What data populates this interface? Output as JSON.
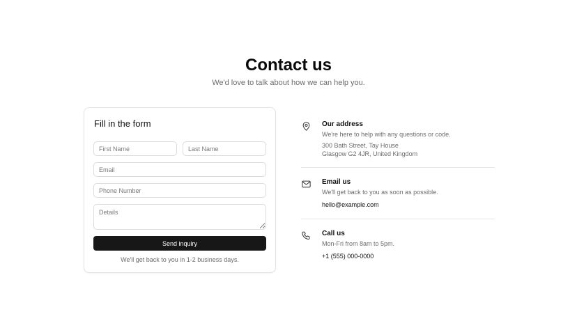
{
  "header": {
    "title": "Contact us",
    "subtitle": "We'd love to talk about how we can help you."
  },
  "form": {
    "title": "Fill in the form",
    "first_name_placeholder": "First Name",
    "last_name_placeholder": "Last Name",
    "email_placeholder": "Email",
    "phone_placeholder": "Phone Number",
    "details_placeholder": "Details",
    "submit_label": "Send inquiry",
    "note": "We'll get back to you in 1-2 business days."
  },
  "contact": {
    "address": {
      "icon": "map-pin-icon",
      "title": "Our address",
      "description": "We're here to help with any questions or code.",
      "line1": "300 Bath Street, Tay House",
      "line2": "Glasgow G2 4JR, United Kingdom"
    },
    "email": {
      "icon": "mail-icon",
      "title": "Email us",
      "description": "We'll get back to you as soon as possible.",
      "value": "hello@example.com"
    },
    "phone": {
      "icon": "phone-icon",
      "title": "Call us",
      "description": "Mon-Fri from 8am to 5pm.",
      "value": "+1 (555) 000-0000"
    }
  },
  "colors": {
    "button_background": "#171717",
    "muted_text": "#6b6b6b",
    "border": "#e3e3e3"
  }
}
